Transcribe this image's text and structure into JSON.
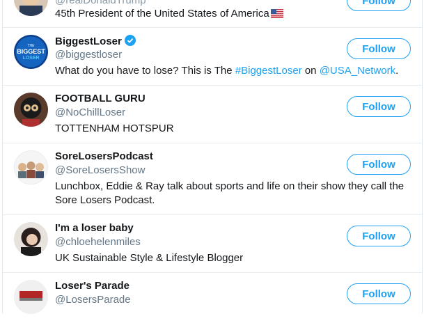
{
  "users": [
    {
      "name": "",
      "handle": "@realDonaldTrump",
      "bio": "45th President of the United States of America",
      "bio_flag": "us-flag-icon",
      "follow_label": "Follow"
    },
    {
      "name": "BiggestLoser",
      "handle": "@biggestloser",
      "verified": true,
      "bio_prefix": "What do you have to lose? This is The ",
      "bio_link1": "#BiggestLoser",
      "bio_mid": " on ",
      "bio_link2": "@USA_Network",
      "bio_suffix": ".",
      "avatar_text_top": "THE",
      "avatar_text_main": "BIGGEST",
      "avatar_text_sub": "LOSER",
      "follow_label": "Follow"
    },
    {
      "name": "FOOTBALL GURU",
      "handle": "@NoChillLoser",
      "bio": "TOTTENHAM HOTSPUR",
      "follow_label": "Follow"
    },
    {
      "name": "SoreLosersPodcast",
      "handle": "@SoreLosersShow",
      "bio": "Lunchbox, Eddie & Ray talk about sports and life on their show they call the Sore Losers Podcast.",
      "follow_label": "Follow"
    },
    {
      "name": "I'm a loser baby",
      "handle": "@chloehelenmiles",
      "bio": "UK Sustainable Style & Lifestyle Blogger",
      "follow_label": "Follow"
    },
    {
      "name": "Loser's Parade",
      "handle": "@LosersParade",
      "follow_label": "Follow"
    }
  ],
  "colors": {
    "accent": "#1da1f2",
    "text": "#14171a",
    "secondary": "#657786",
    "divider": "#e6ecf0"
  }
}
